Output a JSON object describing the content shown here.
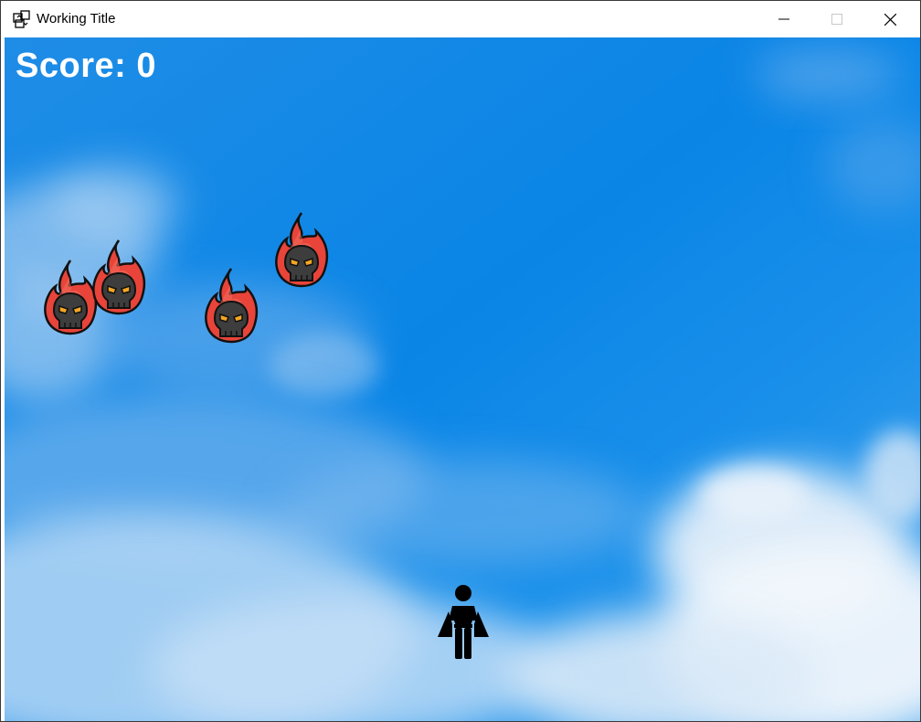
{
  "window": {
    "title": "Working Title",
    "app_icon": "puzzle-icon",
    "controls": {
      "minimize_icon": "minimize-icon",
      "maximize_icon": "maximize-icon",
      "close_icon": "close-icon"
    }
  },
  "game": {
    "score_text": "Score: 0",
    "background": "sky-with-clouds",
    "enemies": [
      {
        "type": "flaming-skull-icon"
      },
      {
        "type": "flaming-skull-icon"
      },
      {
        "type": "flaming-skull-icon"
      },
      {
        "type": "flaming-skull-icon"
      }
    ],
    "player": {
      "type": "hero-figure-icon"
    },
    "colors": {
      "sky": "#0b86e6",
      "flame": "#e8443a",
      "skull": "#3d3d3d",
      "eyes": "#f5a623",
      "player": "#000000",
      "score": "#ffffff"
    }
  }
}
